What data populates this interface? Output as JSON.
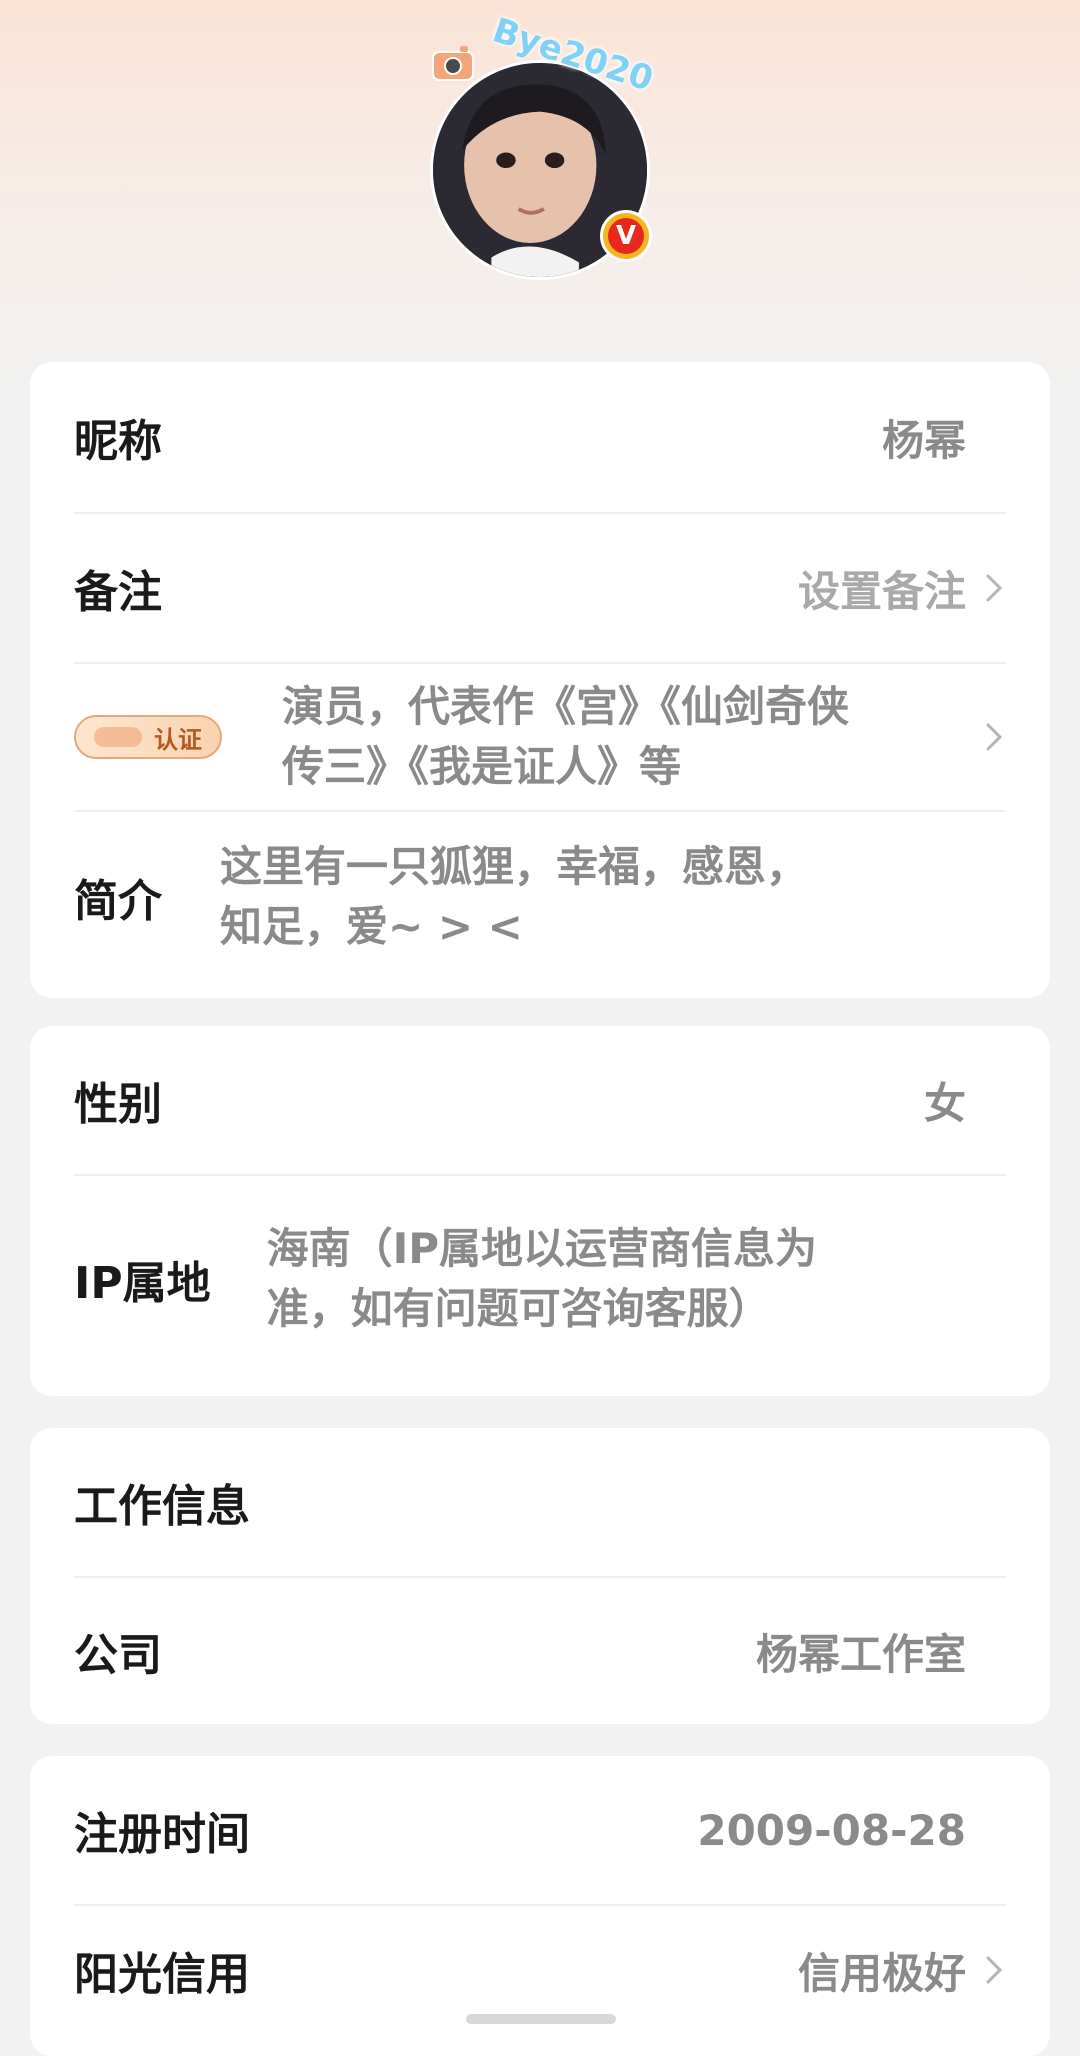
{
  "profile": {
    "sticker_text": "Bye2020",
    "verified_mark": "V"
  },
  "basic": {
    "nickname_label": "昵称",
    "nickname_value": "杨幂",
    "remark_label": "备注",
    "remark_value": "设置备注",
    "cert_badge": "认证",
    "cert_line1": "演员，代表作《宫》《仙剑奇侠",
    "cert_line2": "传三》《我是证人》等",
    "bio_label": "简介",
    "bio_line1": "这里有一只狐狸，幸福，感恩，",
    "bio_line2": "知足，爱~ > <"
  },
  "personal": {
    "gender_label": "性别",
    "gender_value": "女",
    "ip_label": "IP属地",
    "ip_line1": "海南（IP属地以运营商信息为",
    "ip_line2": "准，如有问题可咨询客服）"
  },
  "work": {
    "section_title": "工作信息",
    "company_label": "公司",
    "company_value": "杨幂工作室"
  },
  "account": {
    "register_label": "注册时间",
    "register_value": "2009-08-28",
    "credit_label": "阳光信用",
    "credit_value": "信用极好"
  },
  "colors": {
    "accent_badge": "#e8281e",
    "muted_text": "#8a8a8a",
    "sticker": "#7fd2f5"
  }
}
